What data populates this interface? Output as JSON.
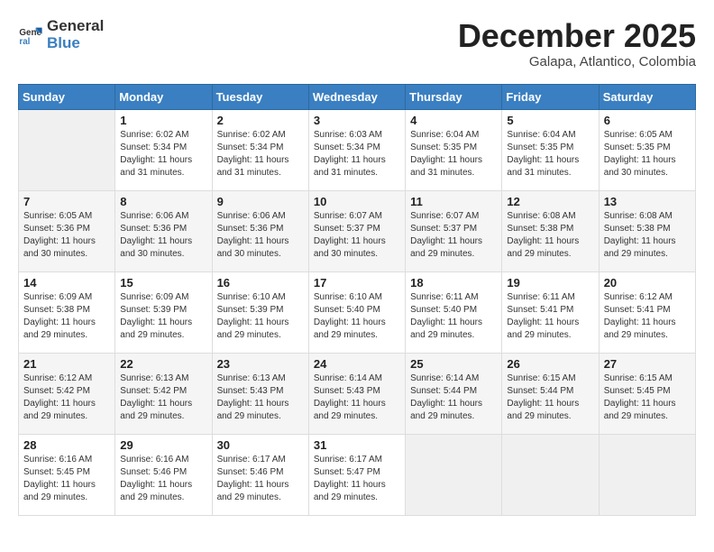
{
  "logo": {
    "text_general": "General",
    "text_blue": "Blue"
  },
  "header": {
    "month": "December 2025",
    "location": "Galapa, Atlantico, Colombia"
  },
  "days_of_week": [
    "Sunday",
    "Monday",
    "Tuesday",
    "Wednesday",
    "Thursday",
    "Friday",
    "Saturday"
  ],
  "weeks": [
    [
      {
        "day": "",
        "sunrise": "",
        "sunset": "",
        "daylight": ""
      },
      {
        "day": "1",
        "sunrise": "6:02 AM",
        "sunset": "5:34 PM",
        "daylight": "11 hours and 31 minutes."
      },
      {
        "day": "2",
        "sunrise": "6:02 AM",
        "sunset": "5:34 PM",
        "daylight": "11 hours and 31 minutes."
      },
      {
        "day": "3",
        "sunrise": "6:03 AM",
        "sunset": "5:34 PM",
        "daylight": "11 hours and 31 minutes."
      },
      {
        "day": "4",
        "sunrise": "6:04 AM",
        "sunset": "5:35 PM",
        "daylight": "11 hours and 31 minutes."
      },
      {
        "day": "5",
        "sunrise": "6:04 AM",
        "sunset": "5:35 PM",
        "daylight": "11 hours and 31 minutes."
      },
      {
        "day": "6",
        "sunrise": "6:05 AM",
        "sunset": "5:35 PM",
        "daylight": "11 hours and 30 minutes."
      }
    ],
    [
      {
        "day": "7",
        "sunrise": "6:05 AM",
        "sunset": "5:36 PM",
        "daylight": "11 hours and 30 minutes."
      },
      {
        "day": "8",
        "sunrise": "6:06 AM",
        "sunset": "5:36 PM",
        "daylight": "11 hours and 30 minutes."
      },
      {
        "day": "9",
        "sunrise": "6:06 AM",
        "sunset": "5:36 PM",
        "daylight": "11 hours and 30 minutes."
      },
      {
        "day": "10",
        "sunrise": "6:07 AM",
        "sunset": "5:37 PM",
        "daylight": "11 hours and 30 minutes."
      },
      {
        "day": "11",
        "sunrise": "6:07 AM",
        "sunset": "5:37 PM",
        "daylight": "11 hours and 29 minutes."
      },
      {
        "day": "12",
        "sunrise": "6:08 AM",
        "sunset": "5:38 PM",
        "daylight": "11 hours and 29 minutes."
      },
      {
        "day": "13",
        "sunrise": "6:08 AM",
        "sunset": "5:38 PM",
        "daylight": "11 hours and 29 minutes."
      }
    ],
    [
      {
        "day": "14",
        "sunrise": "6:09 AM",
        "sunset": "5:38 PM",
        "daylight": "11 hours and 29 minutes."
      },
      {
        "day": "15",
        "sunrise": "6:09 AM",
        "sunset": "5:39 PM",
        "daylight": "11 hours and 29 minutes."
      },
      {
        "day": "16",
        "sunrise": "6:10 AM",
        "sunset": "5:39 PM",
        "daylight": "11 hours and 29 minutes."
      },
      {
        "day": "17",
        "sunrise": "6:10 AM",
        "sunset": "5:40 PM",
        "daylight": "11 hours and 29 minutes."
      },
      {
        "day": "18",
        "sunrise": "6:11 AM",
        "sunset": "5:40 PM",
        "daylight": "11 hours and 29 minutes."
      },
      {
        "day": "19",
        "sunrise": "6:11 AM",
        "sunset": "5:41 PM",
        "daylight": "11 hours and 29 minutes."
      },
      {
        "day": "20",
        "sunrise": "6:12 AM",
        "sunset": "5:41 PM",
        "daylight": "11 hours and 29 minutes."
      }
    ],
    [
      {
        "day": "21",
        "sunrise": "6:12 AM",
        "sunset": "5:42 PM",
        "daylight": "11 hours and 29 minutes."
      },
      {
        "day": "22",
        "sunrise": "6:13 AM",
        "sunset": "5:42 PM",
        "daylight": "11 hours and 29 minutes."
      },
      {
        "day": "23",
        "sunrise": "6:13 AM",
        "sunset": "5:43 PM",
        "daylight": "11 hours and 29 minutes."
      },
      {
        "day": "24",
        "sunrise": "6:14 AM",
        "sunset": "5:43 PM",
        "daylight": "11 hours and 29 minutes."
      },
      {
        "day": "25",
        "sunrise": "6:14 AM",
        "sunset": "5:44 PM",
        "daylight": "11 hours and 29 minutes."
      },
      {
        "day": "26",
        "sunrise": "6:15 AM",
        "sunset": "5:44 PM",
        "daylight": "11 hours and 29 minutes."
      },
      {
        "day": "27",
        "sunrise": "6:15 AM",
        "sunset": "5:45 PM",
        "daylight": "11 hours and 29 minutes."
      }
    ],
    [
      {
        "day": "28",
        "sunrise": "6:16 AM",
        "sunset": "5:45 PM",
        "daylight": "11 hours and 29 minutes."
      },
      {
        "day": "29",
        "sunrise": "6:16 AM",
        "sunset": "5:46 PM",
        "daylight": "11 hours and 29 minutes."
      },
      {
        "day": "30",
        "sunrise": "6:17 AM",
        "sunset": "5:46 PM",
        "daylight": "11 hours and 29 minutes."
      },
      {
        "day": "31",
        "sunrise": "6:17 AM",
        "sunset": "5:47 PM",
        "daylight": "11 hours and 29 minutes."
      },
      {
        "day": "",
        "sunrise": "",
        "sunset": "",
        "daylight": ""
      },
      {
        "day": "",
        "sunrise": "",
        "sunset": "",
        "daylight": ""
      },
      {
        "day": "",
        "sunrise": "",
        "sunset": "",
        "daylight": ""
      }
    ]
  ]
}
